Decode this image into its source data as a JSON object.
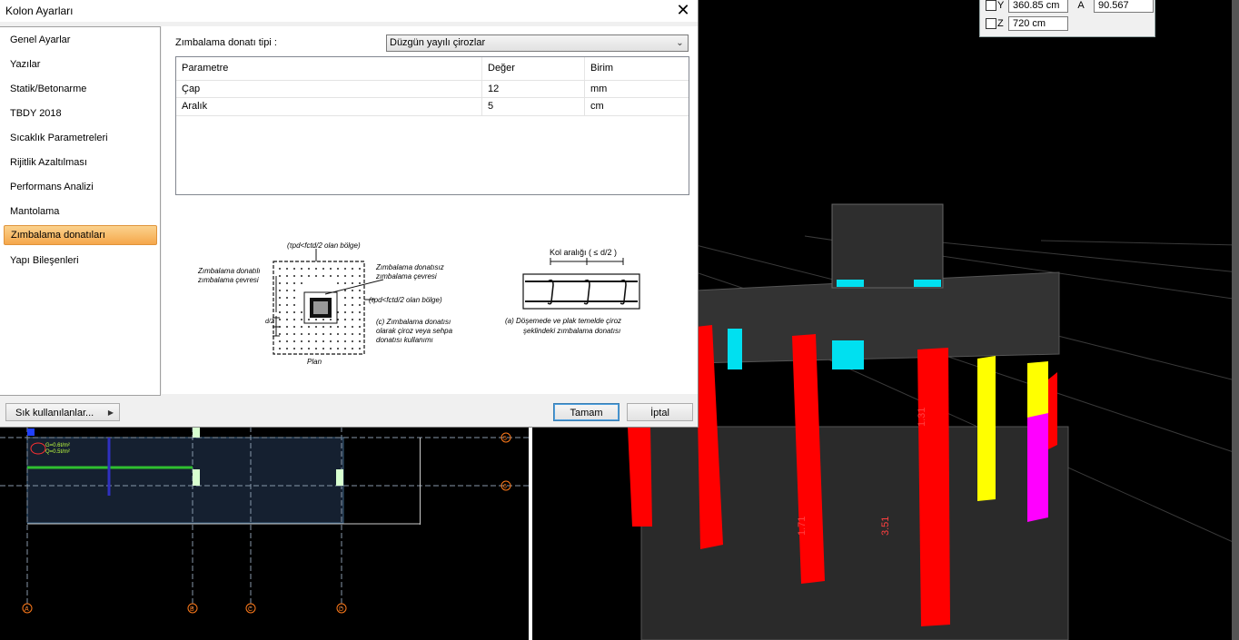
{
  "dialog": {
    "title": "Kolon Ayarları",
    "nav_items": [
      {
        "label": "Genel Ayarlar"
      },
      {
        "label": "Yazılar"
      },
      {
        "label": "Statik/Betonarme"
      },
      {
        "label": "TBDY 2018"
      },
      {
        "label": "Sıcaklık Parametreleri"
      },
      {
        "label": "Rijitlik Azaltılması"
      },
      {
        "label": "Performans Analizi"
      },
      {
        "label": "Mantolama"
      },
      {
        "label": "Zımbalama donatıları",
        "active": true
      },
      {
        "label": "Yapı Bileşenleri"
      }
    ],
    "punching_type_label": "Zımbalama donatı tipi :",
    "punching_type_value": "Düzgün yayılı çirozlar",
    "table": {
      "headers": [
        "Parametre",
        "Değer",
        "Birim"
      ],
      "rows": [
        [
          "Çap",
          "12",
          "mm"
        ],
        [
          "Aralık",
          "5",
          "cm"
        ]
      ]
    },
    "figure": {
      "zone_top_label": "(τpd<fctd/2 olan bölge)",
      "zone_right_label": "(τpd<fctd/2 olan bölge)",
      "label_rebar_perimeter_1": "Zımbalama donatılı",
      "label_rebar_perimeter_2": "zımbalama çevresi",
      "label_norebar_perimeter_1": "Zımbalama donatısız",
      "label_norebar_perimeter_2": "zımbalama çevresi",
      "d_label": "d/2",
      "caption_c_1": "(c) Zımbalama donatısı",
      "caption_c_2": "olarak çiroz veya sehpa",
      "caption_c_3": "donatısı kullanımı",
      "plan_label": "Plan",
      "spacing_label": "Kol aralığı ( ≤ d/2 )",
      "caption_a_1": "(a) Döşemede ve plak temelde çiroz",
      "caption_a_2": "şeklindeki zımbalama donatısı"
    },
    "footer": {
      "favorites_label": "Sık kullanılanlar...",
      "ok_label": "Tamam",
      "cancel_label": "İptal"
    }
  },
  "coord_panel": {
    "y_axis": "Y",
    "y_value": "360.85 cm",
    "a_label": "A",
    "a_value": "90.567",
    "z_axis": "Z",
    "z_value": "720 cm"
  },
  "plan_view": {
    "axis_labels": [
      "A",
      "B",
      "C",
      "D"
    ],
    "row_labels": [
      "5",
      "6"
    ],
    "load_text_1": "G=0.6t/m²",
    "load_text_2": "Q=0.5t/m²"
  },
  "view3d": {
    "column_labels": [
      "1.31",
      "3.51",
      "1.71"
    ]
  }
}
